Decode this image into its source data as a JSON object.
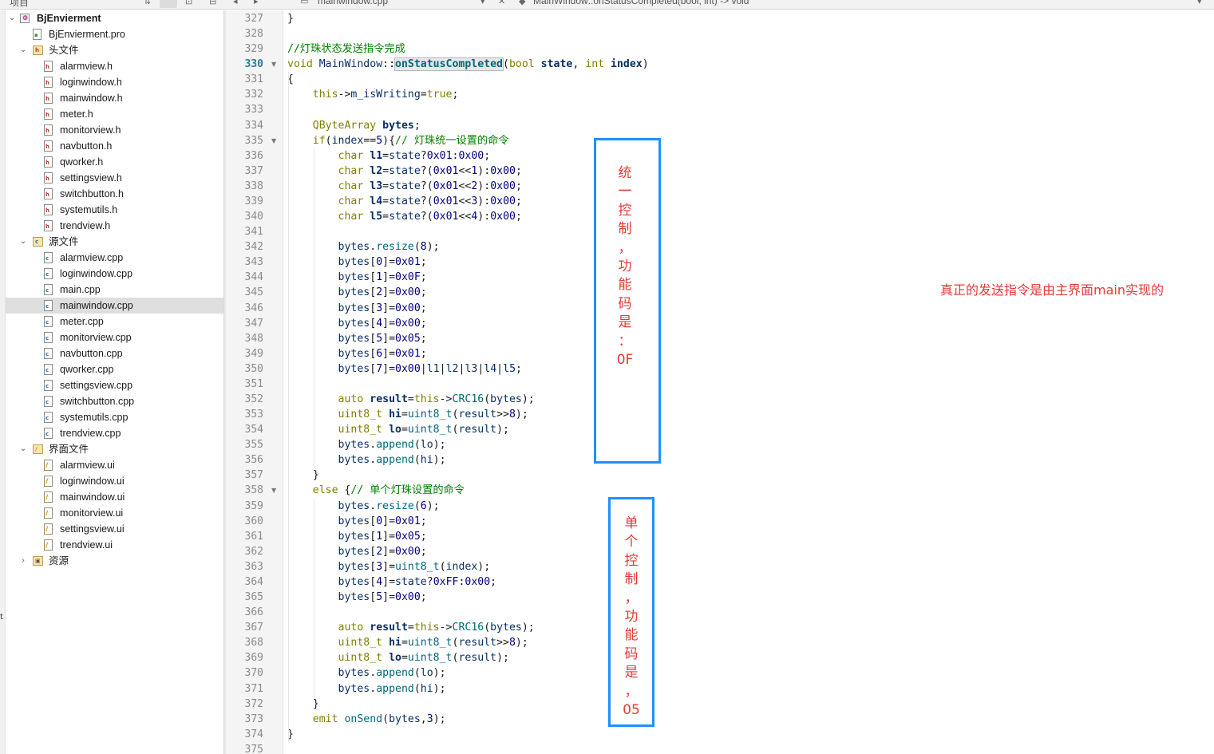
{
  "topbar": {
    "left_text": "项目",
    "file_text": "mainwindow.cpp",
    "symbol_text": "MainWindow::onStatusCompleted(bool, int) -> void"
  },
  "sidebar": {
    "project": "BjEnvierment",
    "items": [
      {
        "label": "BjEnvierment.pro",
        "kind": "pro",
        "level": 1
      },
      {
        "label": "头文件",
        "kind": "folder-h",
        "level": 1
      },
      {
        "label": "alarmview.h",
        "kind": "h",
        "level": 2
      },
      {
        "label": "loginwindow.h",
        "kind": "h",
        "level": 2
      },
      {
        "label": "mainwindow.h",
        "kind": "h",
        "level": 2
      },
      {
        "label": "meter.h",
        "kind": "h",
        "level": 2
      },
      {
        "label": "monitorview.h",
        "kind": "h",
        "level": 2
      },
      {
        "label": "navbutton.h",
        "kind": "h",
        "level": 2
      },
      {
        "label": "qworker.h",
        "kind": "h",
        "level": 2
      },
      {
        "label": "settingsview.h",
        "kind": "h",
        "level": 2
      },
      {
        "label": "switchbutton.h",
        "kind": "h",
        "level": 2
      },
      {
        "label": "systemutils.h",
        "kind": "h",
        "level": 2
      },
      {
        "label": "trendview.h",
        "kind": "h",
        "level": 2
      },
      {
        "label": "源文件",
        "kind": "folder-cpp",
        "level": 1
      },
      {
        "label": "alarmview.cpp",
        "kind": "cpp",
        "level": 2
      },
      {
        "label": "loginwindow.cpp",
        "kind": "cpp",
        "level": 2
      },
      {
        "label": "main.cpp",
        "kind": "cpp",
        "level": 2
      },
      {
        "label": "mainwindow.cpp",
        "kind": "cpp",
        "level": 2,
        "selected": true
      },
      {
        "label": "meter.cpp",
        "kind": "cpp",
        "level": 2
      },
      {
        "label": "monitorview.cpp",
        "kind": "cpp",
        "level": 2
      },
      {
        "label": "navbutton.cpp",
        "kind": "cpp",
        "level": 2
      },
      {
        "label": "qworker.cpp",
        "kind": "cpp",
        "level": 2
      },
      {
        "label": "settingsview.cpp",
        "kind": "cpp",
        "level": 2
      },
      {
        "label": "switchbutton.cpp",
        "kind": "cpp",
        "level": 2
      },
      {
        "label": "systemutils.cpp",
        "kind": "cpp",
        "level": 2
      },
      {
        "label": "trendview.cpp",
        "kind": "cpp",
        "level": 2
      },
      {
        "label": "界面文件",
        "kind": "folder-ui",
        "level": 1
      },
      {
        "label": "alarmview.ui",
        "kind": "ui",
        "level": 2
      },
      {
        "label": "loginwindow.ui",
        "kind": "ui",
        "level": 2
      },
      {
        "label": "mainwindow.ui",
        "kind": "ui",
        "level": 2
      },
      {
        "label": "monitorview.ui",
        "kind": "ui",
        "level": 2
      },
      {
        "label": "settingsview.ui",
        "kind": "ui",
        "level": 2
      },
      {
        "label": "trendview.ui",
        "kind": "ui",
        "level": 2
      },
      {
        "label": "资源",
        "kind": "folder-res",
        "level": 1,
        "collapsed": true
      }
    ]
  },
  "editor": {
    "current_line": 330,
    "lines": [
      {
        "n": 327,
        "text": "}"
      },
      {
        "n": 328,
        "text": ""
      },
      {
        "n": 329,
        "text": "//灯珠状态发送指令完成"
      },
      {
        "n": 330,
        "text": "void MainWindow::onStatusCompleted(bool state, int index)",
        "fold": true
      },
      {
        "n": 331,
        "text": "{"
      },
      {
        "n": 332,
        "text": "    this->m_isWriting=true;"
      },
      {
        "n": 333,
        "text": ""
      },
      {
        "n": 334,
        "text": "    QByteArray bytes;"
      },
      {
        "n": 335,
        "text": "    if(index==5){// 灯珠统一设置的命令",
        "fold": true
      },
      {
        "n": 336,
        "text": "        char l1=state?0x01:0x00;"
      },
      {
        "n": 337,
        "text": "        char l2=state?(0x01<<1):0x00;"
      },
      {
        "n": 338,
        "text": "        char l3=state?(0x01<<2):0x00;"
      },
      {
        "n": 339,
        "text": "        char l4=state?(0x01<<3):0x00;"
      },
      {
        "n": 340,
        "text": "        char l5=state?(0x01<<4):0x00;"
      },
      {
        "n": 341,
        "text": ""
      },
      {
        "n": 342,
        "text": "        bytes.resize(8);"
      },
      {
        "n": 343,
        "text": "        bytes[0]=0x01;"
      },
      {
        "n": 344,
        "text": "        bytes[1]=0x0F;"
      },
      {
        "n": 345,
        "text": "        bytes[2]=0x00;"
      },
      {
        "n": 346,
        "text": "        bytes[3]=0x00;"
      },
      {
        "n": 347,
        "text": "        bytes[4]=0x00;"
      },
      {
        "n": 348,
        "text": "        bytes[5]=0x05;"
      },
      {
        "n": 349,
        "text": "        bytes[6]=0x01;"
      },
      {
        "n": 350,
        "text": "        bytes[7]=0x00|l1|l2|l3|l4|l5;"
      },
      {
        "n": 351,
        "text": ""
      },
      {
        "n": 352,
        "text": "        auto result=this->CRC16(bytes);"
      },
      {
        "n": 353,
        "text": "        uint8_t hi=uint8_t(result>>8);"
      },
      {
        "n": 354,
        "text": "        uint8_t lo=uint8_t(result);"
      },
      {
        "n": 355,
        "text": "        bytes.append(lo);"
      },
      {
        "n": 356,
        "text": "        bytes.append(hi);"
      },
      {
        "n": 357,
        "text": "    }"
      },
      {
        "n": 358,
        "text": "    else {// 单个灯珠设置的命令",
        "fold": true
      },
      {
        "n": 359,
        "text": "        bytes.resize(6);"
      },
      {
        "n": 360,
        "text": "        bytes[0]=0x01;"
      },
      {
        "n": 361,
        "text": "        bytes[1]=0x05;"
      },
      {
        "n": 362,
        "text": "        bytes[2]=0x00;"
      },
      {
        "n": 363,
        "text": "        bytes[3]=uint8_t(index);"
      },
      {
        "n": 364,
        "text": "        bytes[4]=state?0xFF:0x00;"
      },
      {
        "n": 365,
        "text": "        bytes[5]=0x00;"
      },
      {
        "n": 366,
        "text": ""
      },
      {
        "n": 367,
        "text": "        auto result=this->CRC16(bytes);"
      },
      {
        "n": 368,
        "text": "        uint8_t hi=uint8_t(result>>8);"
      },
      {
        "n": 369,
        "text": "        uint8_t lo=uint8_t(result);"
      },
      {
        "n": 370,
        "text": "        bytes.append(lo);"
      },
      {
        "n": 371,
        "text": "        bytes.append(hi);"
      },
      {
        "n": 372,
        "text": "    }"
      },
      {
        "n": 373,
        "text": "    emit onSend(bytes,3);"
      },
      {
        "n": 374,
        "text": "}"
      },
      {
        "n": 375,
        "text": ""
      }
    ]
  },
  "annotations": {
    "box1_text": "统\n一\n控\n制\n，\n功\n能\n码\n是\n：\n0F",
    "box2_text": "单\n个\n控\n制\n，\n功\n能\n码\n是\n，\n05",
    "note": "真正的发送指令是由主界面main实现的"
  },
  "colors": {
    "annotation_box": "#1e90ff",
    "annotation_text": "#e53935",
    "keyword": "#808000",
    "comment": "#008000",
    "number": "#000080"
  }
}
